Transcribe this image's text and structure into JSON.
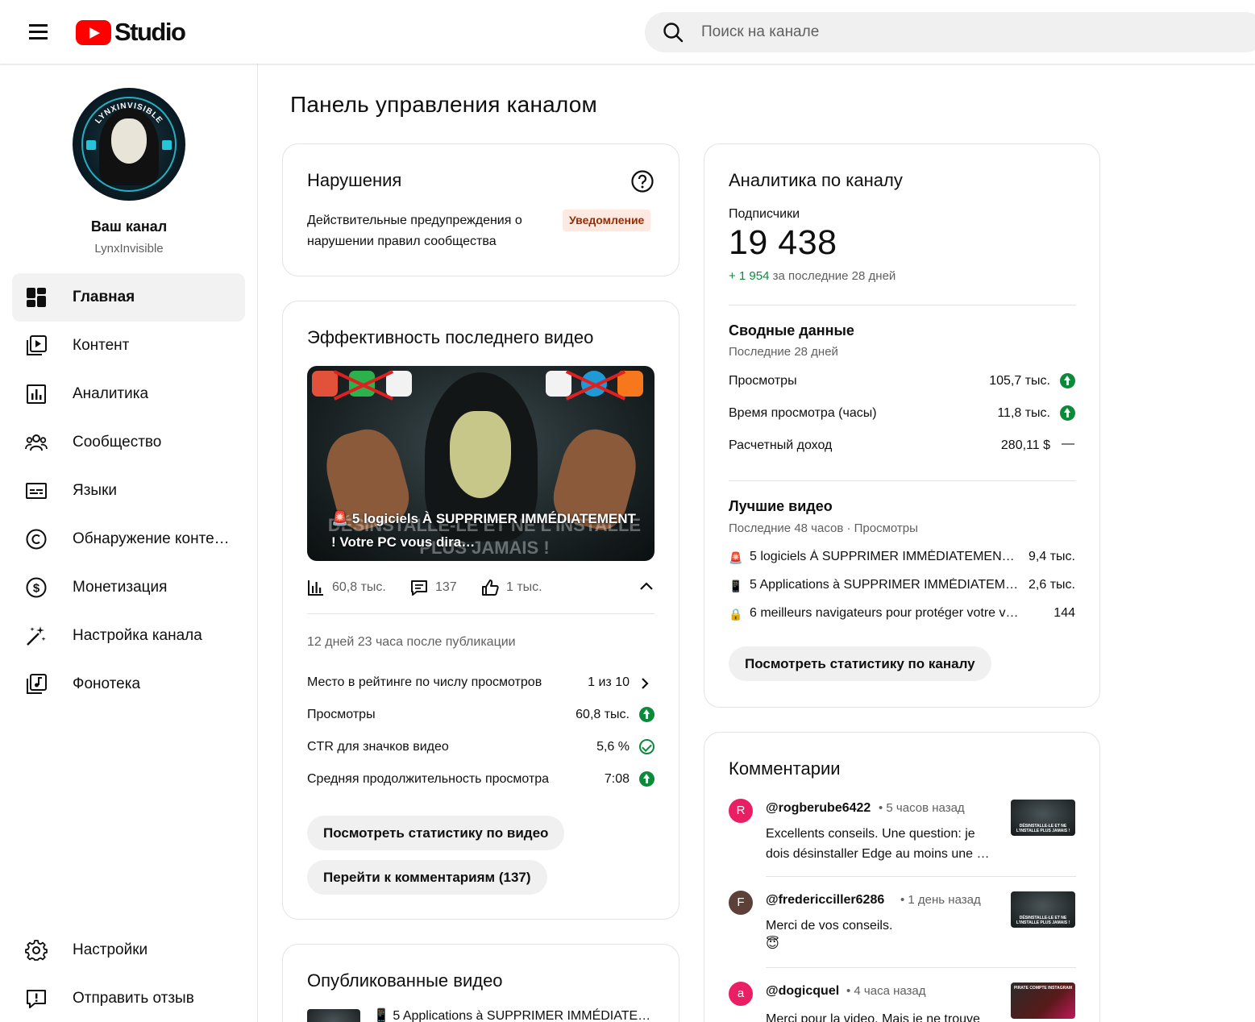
{
  "header": {
    "brand": "Studio",
    "search_placeholder": "Поиск на канале"
  },
  "sidebar": {
    "channel_title": "Ваш канал",
    "channel_handle": "LynxInvisible",
    "avatar_text": "LYNXINVISIBLE",
    "nav": [
      {
        "label": "Главная",
        "icon": "dashboard-icon",
        "active": true
      },
      {
        "label": "Контент",
        "icon": "content-icon"
      },
      {
        "label": "Аналитика",
        "icon": "analytics-icon"
      },
      {
        "label": "Сообщество",
        "icon": "community-icon"
      },
      {
        "label": "Языки",
        "icon": "subtitles-icon"
      },
      {
        "label": "Обнаружение контен…",
        "icon": "copyright-icon"
      },
      {
        "label": "Монетизация",
        "icon": "dollar-icon"
      },
      {
        "label": "Настройка канала",
        "icon": "magic-wand-icon"
      },
      {
        "label": "Фонотека",
        "icon": "audio-library-icon"
      }
    ],
    "bottom": [
      {
        "label": "Настройки",
        "icon": "gear-icon"
      },
      {
        "label": "Отправить отзыв",
        "icon": "feedback-icon"
      }
    ]
  },
  "main": {
    "page_title": "Панель управления каналом",
    "violations": {
      "title": "Нарушения",
      "text": "Действительные предупреждения о нарушении правил сообщества",
      "badge": "Уведомление"
    },
    "latest_video": {
      "title": "Эффективность последнего видео",
      "thumbnail_caption": "🚨 5 logiciels À SUPPRIMER IMMÉDIATEMENT ! Votre PC vous dira…",
      "thumbnail_bg_text": "DÉSINSTALLE-LE ET NE L'INSTALLE PLUS JAMAIS !",
      "views": "60,8 тыс.",
      "comments": "137",
      "likes": "1 тыс.",
      "since_publish": "12 дней 23 часа после публикации",
      "rows": [
        {
          "label": "Место в рейтинге по числу просмотров",
          "value": "1 из 10"
        },
        {
          "label": "Просмотры",
          "value": "60,8 тыс."
        },
        {
          "label": "CTR для значков видео",
          "value": "5,6 %"
        },
        {
          "label": "Средняя продолжительность просмотра",
          "value": "7:08"
        }
      ],
      "btn_stats": "Посмотреть статистику по видео",
      "btn_comments": "Перейти к комментариям (137)"
    },
    "published": {
      "title": "Опубликованные видео",
      "first_item": "📱 5 Applications à SUPPRIMER IMMÉDIATEM…"
    },
    "analytics": {
      "title": "Аналитика по каналу",
      "subs_label": "Подписчики",
      "subs_value": "19 438",
      "subs_delta": "+ 1 954",
      "subs_period": "за последние 28 дней",
      "summary_title": "Сводные данные",
      "summary_period": "Последние 28 дней",
      "summary_rows": [
        {
          "label": "Просмотры",
          "value": "105,7 тыс."
        },
        {
          "label": "Время просмотра (часы)",
          "value": "11,8 тыс."
        },
        {
          "label": "Расчетный доход",
          "value": "280,11 $"
        }
      ],
      "summary_neutral": "—",
      "top_title": "Лучшие видео",
      "top_period": "Последние 48 часов · Просмотры",
      "top_videos": [
        {
          "emoji": "🚨",
          "title": "5 logiciels À SUPPRIMER IMMÉDIATEMENT !…",
          "value": "9,4 тыс."
        },
        {
          "emoji": "📱",
          "title": "5 Applications à SUPPRIMER IMMÉDIATEME…",
          "value": "2,6 тыс."
        },
        {
          "emoji": "🔒",
          "title": "6 meilleurs navigateurs pour protéger votre v…",
          "value": "144"
        }
      ],
      "btn": "Посмотреть статистику по каналу"
    },
    "comments": {
      "title": "Комментарии",
      "items": [
        {
          "initial": "R",
          "color": "#e91e63",
          "author": "@rogberube6422",
          "time": "• 5 часов назад",
          "text": "Excellents conseils. Une question: je dois désinstaller Edge au moins une …",
          "thumb_text": "DÉSINSTALLE-LE ET NE L'INSTALLE PLUS JAMAIS !"
        },
        {
          "initial": "F",
          "color": "#5d4037",
          "author": "@fredericciller6286",
          "time": "• 1 день назад",
          "text": "Merci de vos conseils.",
          "emoji": "😇",
          "thumb_text": "DÉSINSTALLE-LE ET NE L'INSTALLE PLUS JAMAIS !"
        },
        {
          "initial": "a",
          "color": "#e91e63",
          "author": "@dogicquel",
          "time": "• 4 часа назад",
          "text": "Merci pour la video. Mais je ne trouve",
          "thumb_text": "PIRATE COMPTE INSTAGRAM"
        }
      ]
    }
  }
}
